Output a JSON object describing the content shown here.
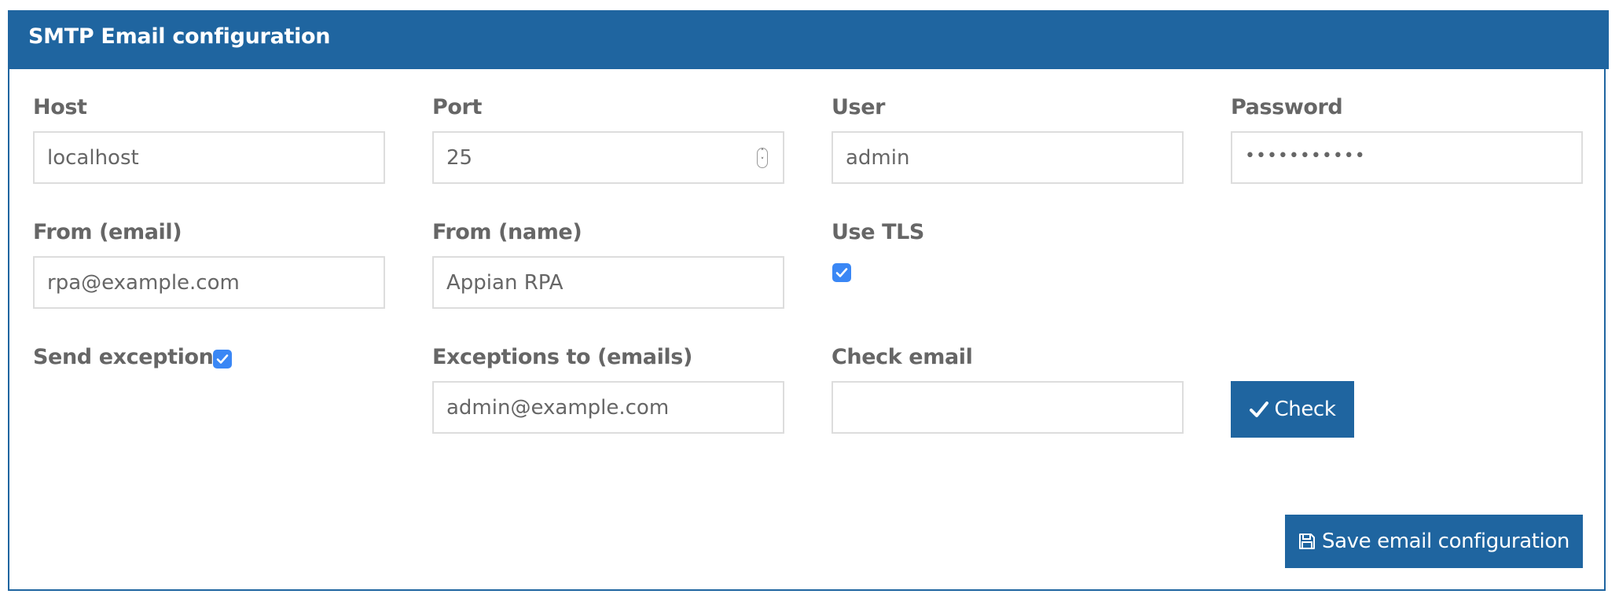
{
  "panel": {
    "title": "SMTP Email configuration"
  },
  "fields": {
    "host": {
      "label": "Host",
      "value": "localhost"
    },
    "port": {
      "label": "Port",
      "value": "25"
    },
    "user": {
      "label": "User",
      "value": "admin"
    },
    "password": {
      "label": "Password",
      "masked_value": "•••••••••••"
    },
    "from_email": {
      "label": "From (email)",
      "value": "rpa@example.com"
    },
    "from_name": {
      "label": "From (name)",
      "value": "Appian RPA"
    },
    "use_tls": {
      "label": "Use TLS",
      "checked": true
    },
    "send_exceptions": {
      "label": "Send exceptions",
      "checked": true
    },
    "exceptions_to": {
      "label": "Exceptions to (emails)",
      "value": "admin@example.com"
    },
    "check_email": {
      "label": "Check email",
      "value": ""
    }
  },
  "buttons": {
    "check": {
      "label": "Check",
      "icon": "checkmark-icon"
    },
    "save": {
      "label": "Save email configuration",
      "icon": "floppy-disk-icon"
    }
  },
  "colors": {
    "primary": "#1f65a0",
    "checkbox": "#3a87f5",
    "label_text": "#666666",
    "input_border": "#dddddd"
  }
}
